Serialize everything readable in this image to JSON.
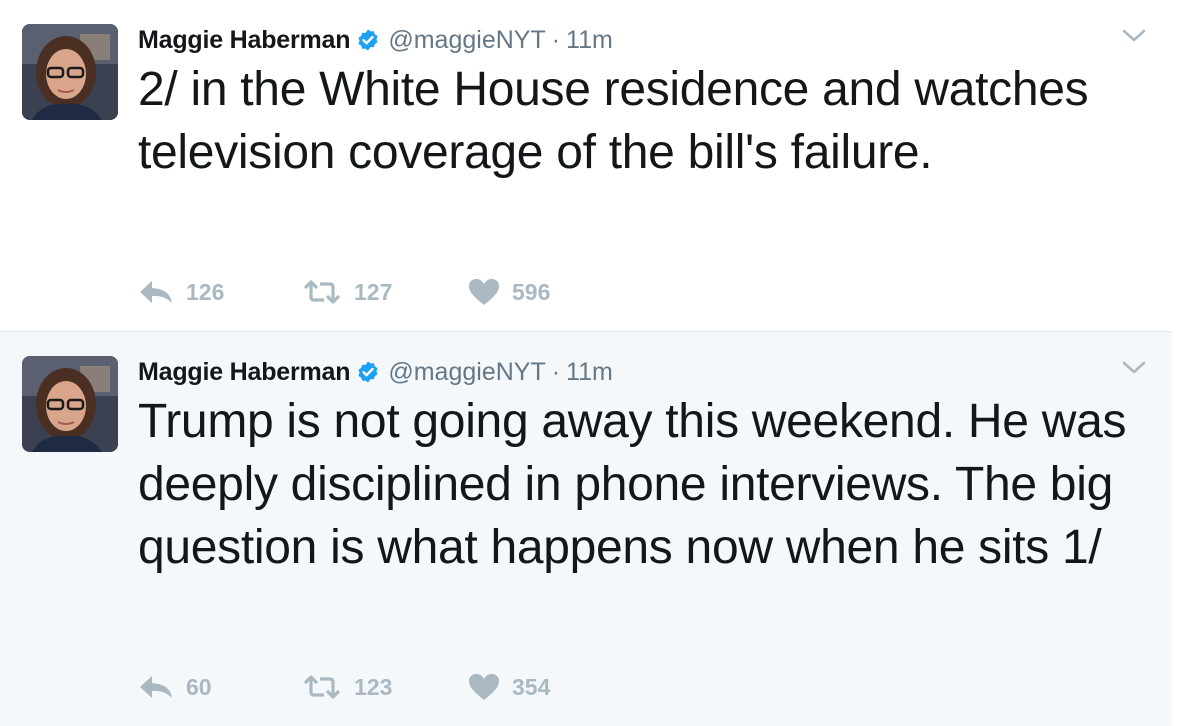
{
  "tweets": [
    {
      "author_name": "Maggie Haberman",
      "handle": "@maggieNYT",
      "separator": "·",
      "time": "11m",
      "text": "2/ in the White House residence and watches television coverage of the bill's failure.",
      "replies": "126",
      "retweets": "127",
      "likes": "596"
    },
    {
      "author_name": "Maggie Haberman",
      "handle": "@maggieNYT",
      "separator": "·",
      "time": "11m",
      "text": "Trump is not going away this weekend. He was deeply disciplined in phone interviews. The big question is what happens now when he sits 1/",
      "replies": "60",
      "retweets": "123",
      "likes": "354"
    }
  ],
  "icons": {
    "verified": "verified-badge-icon",
    "more": "chevron-down-icon",
    "reply": "reply-icon",
    "retweet": "retweet-icon",
    "like": "heart-icon"
  },
  "colors": {
    "verified_blue": "#1da1f2",
    "muted_gray": "#657786",
    "action_gray": "#aab8c2",
    "highlight_bg": "#f5f8fa"
  }
}
